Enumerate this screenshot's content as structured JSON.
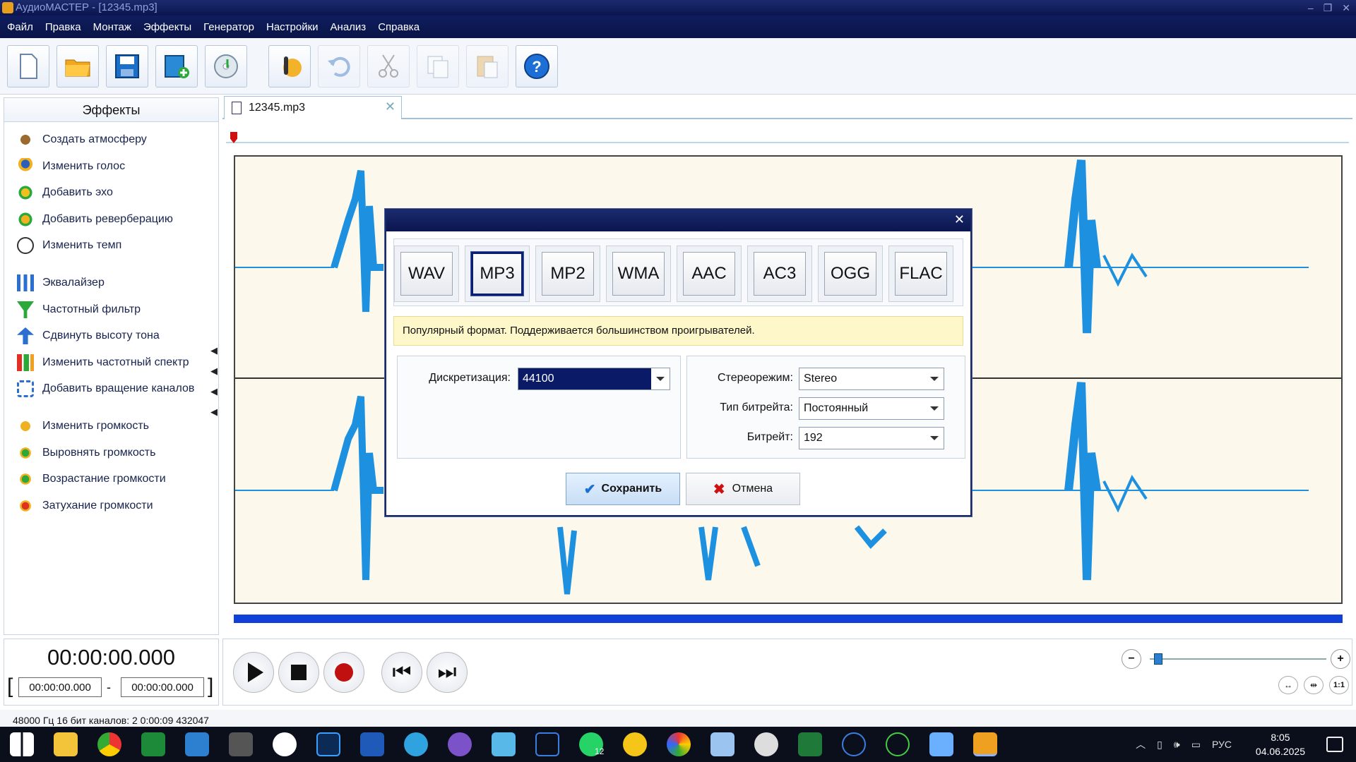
{
  "window": {
    "title": "АудиоМАСТЕР - [12345.mp3]"
  },
  "menu": [
    "Файл",
    "Правка",
    "Монтаж",
    "Эффекты",
    "Генератор",
    "Настройки",
    "Анализ",
    "Справка"
  ],
  "toolbar_icons": [
    "new-file-icon",
    "open-folder-icon",
    "save-icon",
    "add-video-icon",
    "cd-audio-icon",
    "record-voice-icon",
    "undo-icon",
    "cut-icon",
    "copy-icon",
    "paste-icon",
    "help-icon"
  ],
  "effects_panel": {
    "title": "Эффекты",
    "items": [
      "Создать атмосферу",
      "Изменить голос",
      "Добавить эхо",
      "Добавить реверберацию",
      "Изменить темп",
      "Эквалайзер",
      "Частотный фильтр",
      "Сдвинуть высоту тона",
      "Изменить частотный спектр",
      "Добавить вращение каналов",
      "Изменить громкость",
      "Выровнять громкость",
      "Возрастание громкости",
      "Затухание громкости"
    ]
  },
  "file_tab": {
    "label": "12345.mp3"
  },
  "time": {
    "current": "00:00:00.000",
    "start": "00:00:00.000",
    "end": "00:00:00.000",
    "dash": "-"
  },
  "status": {
    "text": "48000 Гц  16 бит  каналов: 2   0:00:09 432047"
  },
  "dialog": {
    "formats": [
      "WAV",
      "MP3",
      "MP2",
      "WMA",
      "AAC",
      "AC3",
      "OGG",
      "FLAC"
    ],
    "selected_format": "MP3",
    "hint": "Популярный формат. Поддерживается большинством проигрывателей.",
    "sampling_label": "Дискретизация:",
    "sampling_value": "44100",
    "stereo_label": "Стереорежим:",
    "stereo_value": "Stereo",
    "bitrate_type_label": "Тип битрейта:",
    "bitrate_type_value": "Постоянный",
    "bitrate_label": "Битрейт:",
    "bitrate_value": "192",
    "save_label": "Сохранить",
    "cancel_label": "Отмена"
  },
  "taskbar": {
    "lang": "РУС",
    "time": "8:05",
    "date": "04.06.2025",
    "badge": "12"
  },
  "colors": {
    "accent": "#0b1550",
    "wave": "#1e90e0",
    "wave_bg": "#fcf8ec",
    "hint_bg": "#fdf7c9"
  }
}
